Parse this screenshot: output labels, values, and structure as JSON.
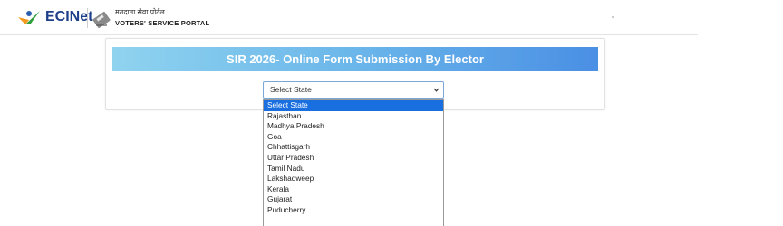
{
  "header": {
    "logo_text": "ECINet",
    "portal_name_hindi": "मतदाता सेवा पोर्टल",
    "portal_name_en": "VOTERS' SERVICE PORTAL"
  },
  "form": {
    "title": "SIR 2026- Online Form Submission By Elector",
    "state_select": {
      "selected": "Select State",
      "options": [
        "Select State",
        "Rajasthan",
        "Madhya Pradesh",
        "Goa",
        "Chhattisgarh",
        "Uttar Pradesh",
        "Tamil Nadu",
        "Lakshadweep",
        "Kerala",
        "Gujarat",
        "Puducherry"
      ]
    }
  },
  "colors": {
    "brand_blue": "#1e3f8a",
    "banner_start": "#8fd3ef",
    "banner_end": "#4a8fe4",
    "option_highlight": "#1a6fe0"
  }
}
